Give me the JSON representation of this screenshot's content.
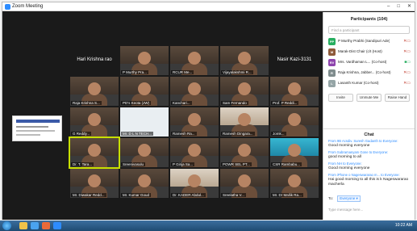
{
  "window": {
    "title": "Zoom Meeting",
    "controls": [
      "–",
      "□",
      "✕"
    ]
  },
  "tiles": [
    {
      "name": "Hari Krishna rao",
      "kind": "text"
    },
    {
      "name": "P Murthy Pra...",
      "kind": "video"
    },
    {
      "name": "RCUR Me...",
      "kind": "video"
    },
    {
      "name": "Vijayalakshmi R...",
      "kind": "video"
    },
    {
      "name": "Nasir Kazi-3131",
      "kind": "text"
    },
    {
      "name": "Raja Krishna S...",
      "kind": "video"
    },
    {
      "name": "PD's Keota (JW)",
      "kind": "video"
    },
    {
      "name": "Kanchari...",
      "kind": "video"
    },
    {
      "name": "Sam Fernando",
      "kind": "video"
    },
    {
      "name": "Prof. P Reddi...",
      "kind": "video"
    },
    {
      "name": "G Reddy...",
      "kind": "video"
    },
    {
      "name": "Mr. D L N TECH...",
      "kind": "screen"
    },
    {
      "name": "Ramesh Ra...",
      "kind": "video"
    },
    {
      "name": "Ramesh Dingara...",
      "kind": "video"
    },
    {
      "name": "Jomk...",
      "kind": "video"
    },
    {
      "name": "Dr. T. Tara...",
      "kind": "video"
    },
    {
      "name": "Sreenivasulu",
      "kind": "video"
    },
    {
      "name": "P Girija Sa...",
      "kind": "video"
    },
    {
      "name": "POWR SEL PT...",
      "kind": "video"
    },
    {
      "name": "CSR Rambabu...",
      "kind": "video"
    },
    {
      "name": "Mr. Diwakar Redd...",
      "kind": "video"
    },
    {
      "name": "Mr. Kumar Goud",
      "kind": "video"
    },
    {
      "name": "Dr. KADER Abdul...",
      "kind": "video"
    },
    {
      "name": "Sreelatha V...",
      "kind": "video"
    },
    {
      "name": "Mr. Dr Mallik Ra...",
      "kind": "video"
    }
  ],
  "participants": {
    "header": "Participants (104)",
    "search_placeholder": "Find a participant",
    "list": [
      {
        "initials": "PP",
        "name": "P Murthy Prabhi (Sandipuri Ade)",
        "color": "#27ae60"
      },
      {
        "initials": "M",
        "name": "Marak-Dist Chair (c/t (Host)",
        "color": "#8e5a3a"
      },
      {
        "initials": "RV",
        "name": "Mrs. Vardhaman L... (Co-host)",
        "color": "#8e44ad"
      },
      {
        "initials": "R",
        "name": "Raja Krishna, Jabber... (Co-host)",
        "color": "#7f8c8d"
      },
      {
        "initials": "L",
        "name": "Lasanth Kumar (Co-host)",
        "color": "#95a5a6"
      }
    ],
    "buttons": [
      "Invite",
      "Unmute Me",
      "Raise Hand"
    ]
  },
  "chat": {
    "header": "Chat",
    "messages": [
      {
        "from": "From 9B Acsdiv. Suresh Gadanth to Everyone:",
        "text": "Good morning everyone"
      },
      {
        "from": "From Subramanyam Gone to Everyone:",
        "text": "good morning to all"
      },
      {
        "from": "From NH to Everyone:",
        "text": "Good morning everyone"
      },
      {
        "from": "From iPhone o Nageswararao m... to Everyone:",
        "text": "Hai good morning to all this is k Nageswararao macherla"
      }
    ],
    "to_label": "To:",
    "to_value": "Everyone ▾",
    "input_placeholder": "Type message here..."
  },
  "taskbar": {
    "time": "10:22 AM"
  }
}
